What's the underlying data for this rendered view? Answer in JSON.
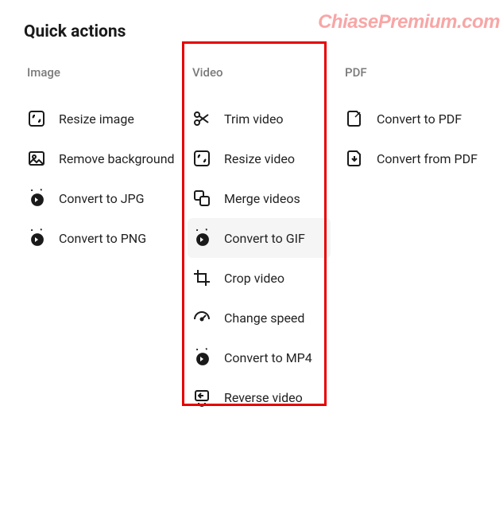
{
  "page": {
    "title": "Quick actions",
    "watermark": "ChiasePremium.com"
  },
  "columns": {
    "image": {
      "heading": "Image",
      "items": [
        {
          "label": "Resize image",
          "icon": "resize-image-icon"
        },
        {
          "label": "Remove background",
          "icon": "remove-background-icon"
        },
        {
          "label": "Convert to JPG",
          "icon": "convert-jpg-icon"
        },
        {
          "label": "Convert to PNG",
          "icon": "convert-png-icon"
        }
      ]
    },
    "video": {
      "heading": "Video",
      "items": [
        {
          "label": "Trim video",
          "icon": "trim-icon"
        },
        {
          "label": "Resize video",
          "icon": "resize-video-icon"
        },
        {
          "label": "Merge videos",
          "icon": "merge-icon"
        },
        {
          "label": "Convert to GIF",
          "icon": "convert-gif-icon",
          "hover": true
        },
        {
          "label": "Crop video",
          "icon": "crop-icon"
        },
        {
          "label": "Change speed",
          "icon": "speed-icon"
        },
        {
          "label": "Convert to MP4",
          "icon": "convert-mp4-icon"
        },
        {
          "label": "Reverse video",
          "icon": "reverse-icon"
        }
      ]
    },
    "pdf": {
      "heading": "PDF",
      "items": [
        {
          "label": "Convert to PDF",
          "icon": "convert-to-pdf-icon"
        },
        {
          "label": "Convert from PDF",
          "icon": "convert-from-pdf-icon"
        }
      ]
    }
  },
  "annotation": {
    "highlight_column": "video",
    "highlight_color": "#e60000"
  }
}
